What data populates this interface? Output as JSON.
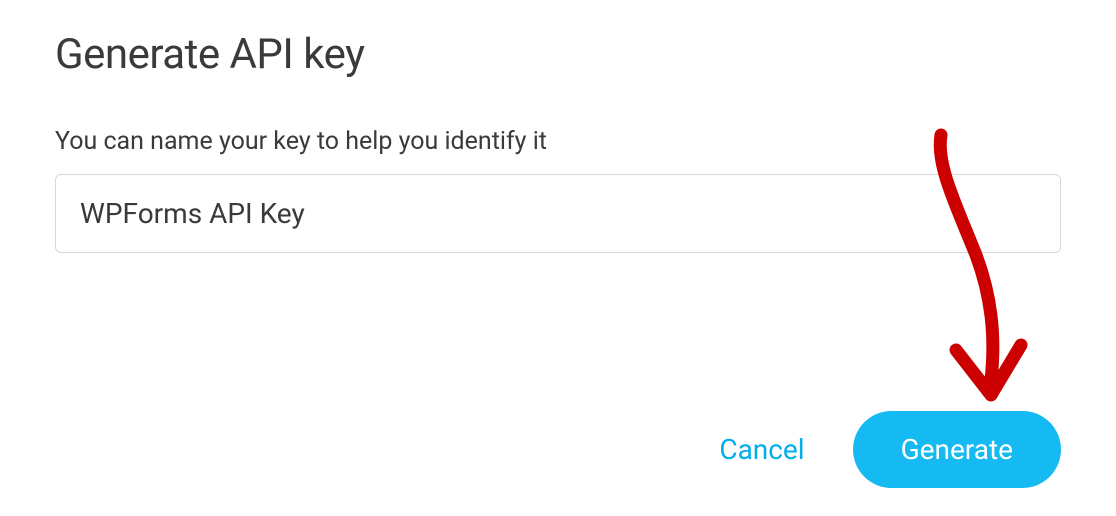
{
  "dialog": {
    "title": "Generate API key",
    "field_label": "You can name your key to help you identify it",
    "input_value": "WPForms API Key",
    "cancel_label": "Cancel",
    "generate_label": "Generate"
  }
}
